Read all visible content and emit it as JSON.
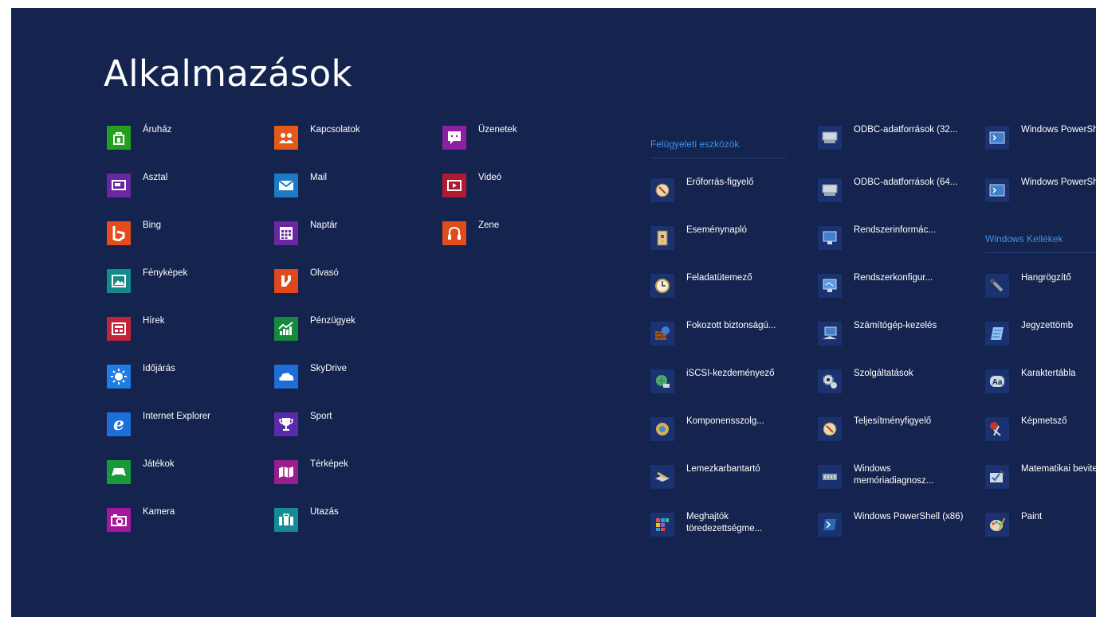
{
  "title": "Alkalmazások",
  "groups": {
    "admin": "Felügyeleti eszközök",
    "accessories": "Windows Kellékek"
  },
  "col1": [
    {
      "label": "Áruház",
      "color": "#24a01e",
      "icon": "store-icon"
    },
    {
      "label": "Asztal",
      "color": "#6a27a2",
      "icon": "desktop-icon"
    },
    {
      "label": "Bing",
      "color": "#e54c1a",
      "icon": "bing-icon"
    },
    {
      "label": "Fényképek",
      "color": "#148a8a",
      "icon": "photos-icon"
    },
    {
      "label": "Hírek",
      "color": "#c0233a",
      "icon": "news-icon"
    },
    {
      "label": "Időjárás",
      "color": "#1d7de3",
      "icon": "weather-icon"
    },
    {
      "label": "Internet Explorer",
      "color": "#1d6ed8",
      "icon": "ie-icon"
    },
    {
      "label": "Játékok",
      "color": "#179a3a",
      "icon": "games-icon"
    },
    {
      "label": "Kamera",
      "color": "#a4179c",
      "icon": "camera-icon"
    }
  ],
  "col2": [
    {
      "label": "Kapcsolatok",
      "color": "#e2591a",
      "icon": "people-icon"
    },
    {
      "label": "Mail",
      "color": "#1d7ac4",
      "icon": "mail-icon"
    },
    {
      "label": "Naptár",
      "color": "#6a27a2",
      "icon": "calendar-icon"
    },
    {
      "label": "Olvasó",
      "color": "#e0471c",
      "icon": "reader-icon"
    },
    {
      "label": "Pénzügyek",
      "color": "#158a3c",
      "icon": "finance-icon"
    },
    {
      "label": "SkyDrive",
      "color": "#1d6ed8",
      "icon": "skydrive-icon"
    },
    {
      "label": "Sport",
      "color": "#5b2aa8",
      "icon": "trophy-icon"
    },
    {
      "label": "Térképek",
      "color": "#9b1c8e",
      "icon": "maps-icon"
    },
    {
      "label": "Utazás",
      "color": "#158c94",
      "icon": "travel-icon"
    }
  ],
  "col3": [
    {
      "label": "Üzenetek",
      "color": "#8e1fa2",
      "icon": "messaging-icon"
    },
    {
      "label": "Videó",
      "color": "#b01a30",
      "icon": "video-icon"
    },
    {
      "label": "Zene",
      "color": "#e04d1c",
      "icon": "music-icon"
    }
  ],
  "col4": [
    {
      "label": "Erőforrás-figyelő",
      "icon": "resource-monitor-icon"
    },
    {
      "label": "Eseménynapló",
      "icon": "event-viewer-icon"
    },
    {
      "label": "Feladatütemező",
      "icon": "task-scheduler-icon"
    },
    {
      "label": "Fokozott biztonságú...",
      "icon": "firewall-icon"
    },
    {
      "label": "iSCSI-kezdeményező",
      "icon": "iscsi-icon"
    },
    {
      "label": "Komponensszolg...",
      "icon": "component-services-icon"
    },
    {
      "label": "Lemezkarbantartó",
      "icon": "disk-cleanup-icon"
    },
    {
      "label": "Meghajtók töredezettségme...",
      "icon": "defrag-icon"
    }
  ],
  "col5": [
    {
      "label": "ODBC-adatforrások (32...",
      "icon": "odbc-icon"
    },
    {
      "label": "ODBC-adatforrások (64...",
      "icon": "odbc-icon"
    },
    {
      "label": "Rendszerinformác...",
      "icon": "system-info-icon"
    },
    {
      "label": "Rendszerkonfigur...",
      "icon": "msconfig-icon"
    },
    {
      "label": "Számítógép-kezelés",
      "icon": "computer-management-icon"
    },
    {
      "label": "Szolgáltatások",
      "icon": "services-icon"
    },
    {
      "label": "Teljesítményfigyelő",
      "icon": "performance-monitor-icon"
    },
    {
      "label": "Windows memóriadiagnosz...",
      "icon": "memory-diagnostic-icon"
    },
    {
      "label": "Windows PowerShell (x86)",
      "icon": "powershell-icon"
    }
  ],
  "col6": [
    {
      "label": "Windows PowerShell ISE",
      "icon": "powershell-ise-icon"
    },
    {
      "label": "Windows PowerShell ISE",
      "icon": "powershell-ise-icon"
    },
    {
      "label": "Hangrögzítő",
      "icon": "sound-recorder-icon"
    },
    {
      "label": "Jegyzettömb",
      "icon": "notepad-icon"
    },
    {
      "label": "Karaktertábla",
      "icon": "character-map-icon"
    },
    {
      "label": "Képmetsző",
      "icon": "snipping-tool-icon"
    },
    {
      "label": "Matematikai beviteli panel",
      "icon": "math-input-icon"
    },
    {
      "label": "Paint",
      "icon": "paint-icon"
    }
  ]
}
